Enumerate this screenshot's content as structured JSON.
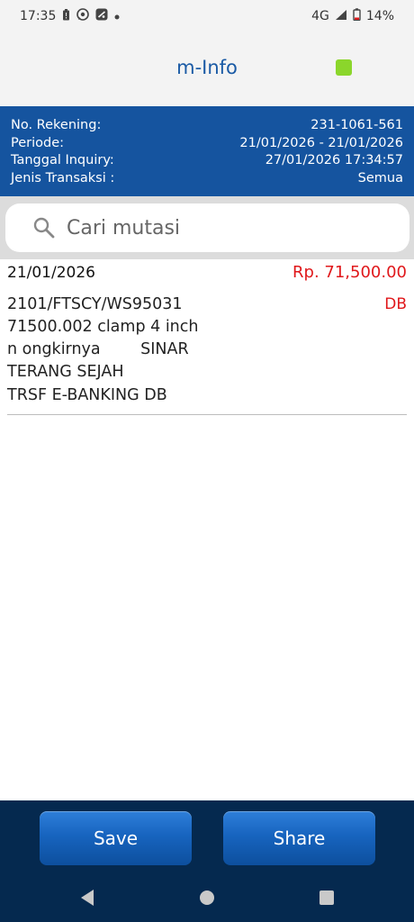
{
  "status_bar": {
    "time": "17:35",
    "network": "4G",
    "battery": "14%",
    "icons": [
      "battery-alert-icon",
      "whatsapp-icon",
      "app-notification-icon",
      "dot-icon",
      "signal-icon",
      "battery-icon"
    ]
  },
  "header": {
    "title": "m-Info",
    "status_indicator_color": "#8bd62b"
  },
  "account_info": {
    "rekening_label": "No. Rekening:",
    "rekening_value": "231-1061-561",
    "periode_label": "Periode:",
    "periode_value": "21/01/2026 - 21/01/2026",
    "tanggal_label": "Tanggal Inquiry:",
    "tanggal_value": "27/01/2026 17:34:57",
    "jenis_label": "Jenis Transaksi :",
    "jenis_value": "Semua"
  },
  "search": {
    "placeholder": "Cari mutasi",
    "value": ""
  },
  "transactions": [
    {
      "date": "21/01/2026",
      "amount": "Rp. 71,500.00",
      "type": "DB",
      "description": "2101/FTSCY/WS95031\n71500.002 clamp 4 inch\nn ongkirnya        SINAR\nTERANG SEJAH",
      "channel": "TRSF E-BANKING DB"
    }
  ],
  "actions": {
    "save_label": "Save",
    "share_label": "Share"
  },
  "colors": {
    "brand_blue": "#15549f",
    "amount_red": "#e0181b",
    "bottom_bar": "#05294f"
  }
}
